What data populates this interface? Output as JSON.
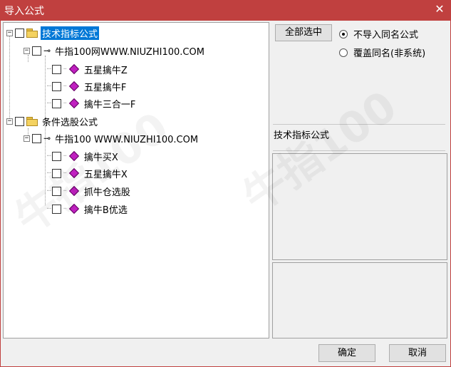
{
  "window": {
    "title": "导入公式",
    "close_glyph": "✕"
  },
  "tree": {
    "items": [
      {
        "label": "技术指标公式",
        "selected": true
      },
      {
        "label": "牛指100网WWW.NIUZHI100.COM"
      },
      {
        "label": "五星擒牛Z"
      },
      {
        "label": "五星擒牛F"
      },
      {
        "label": "擒牛三合一F"
      },
      {
        "label": "条件选股公式"
      },
      {
        "label": "牛指100 WWW.NIUZHI100.COM"
      },
      {
        "label": "擒牛买X"
      },
      {
        "label": "五星擒牛X"
      },
      {
        "label": "抓牛仓选股"
      },
      {
        "label": "擒牛B优选"
      }
    ]
  },
  "options": {
    "select_all_label": "全部选中",
    "radio_no_import": "不导入同名公式",
    "radio_overwrite": "覆盖同名(非系统)",
    "selected_radio": "no_import"
  },
  "detail": {
    "category_name": "技术指标公式"
  },
  "footer": {
    "ok_label": "确定",
    "cancel_label": "取消"
  },
  "colors": {
    "titlebar": "#c0403f",
    "selection": "#0078d7",
    "item_icon": "#c020c0"
  }
}
